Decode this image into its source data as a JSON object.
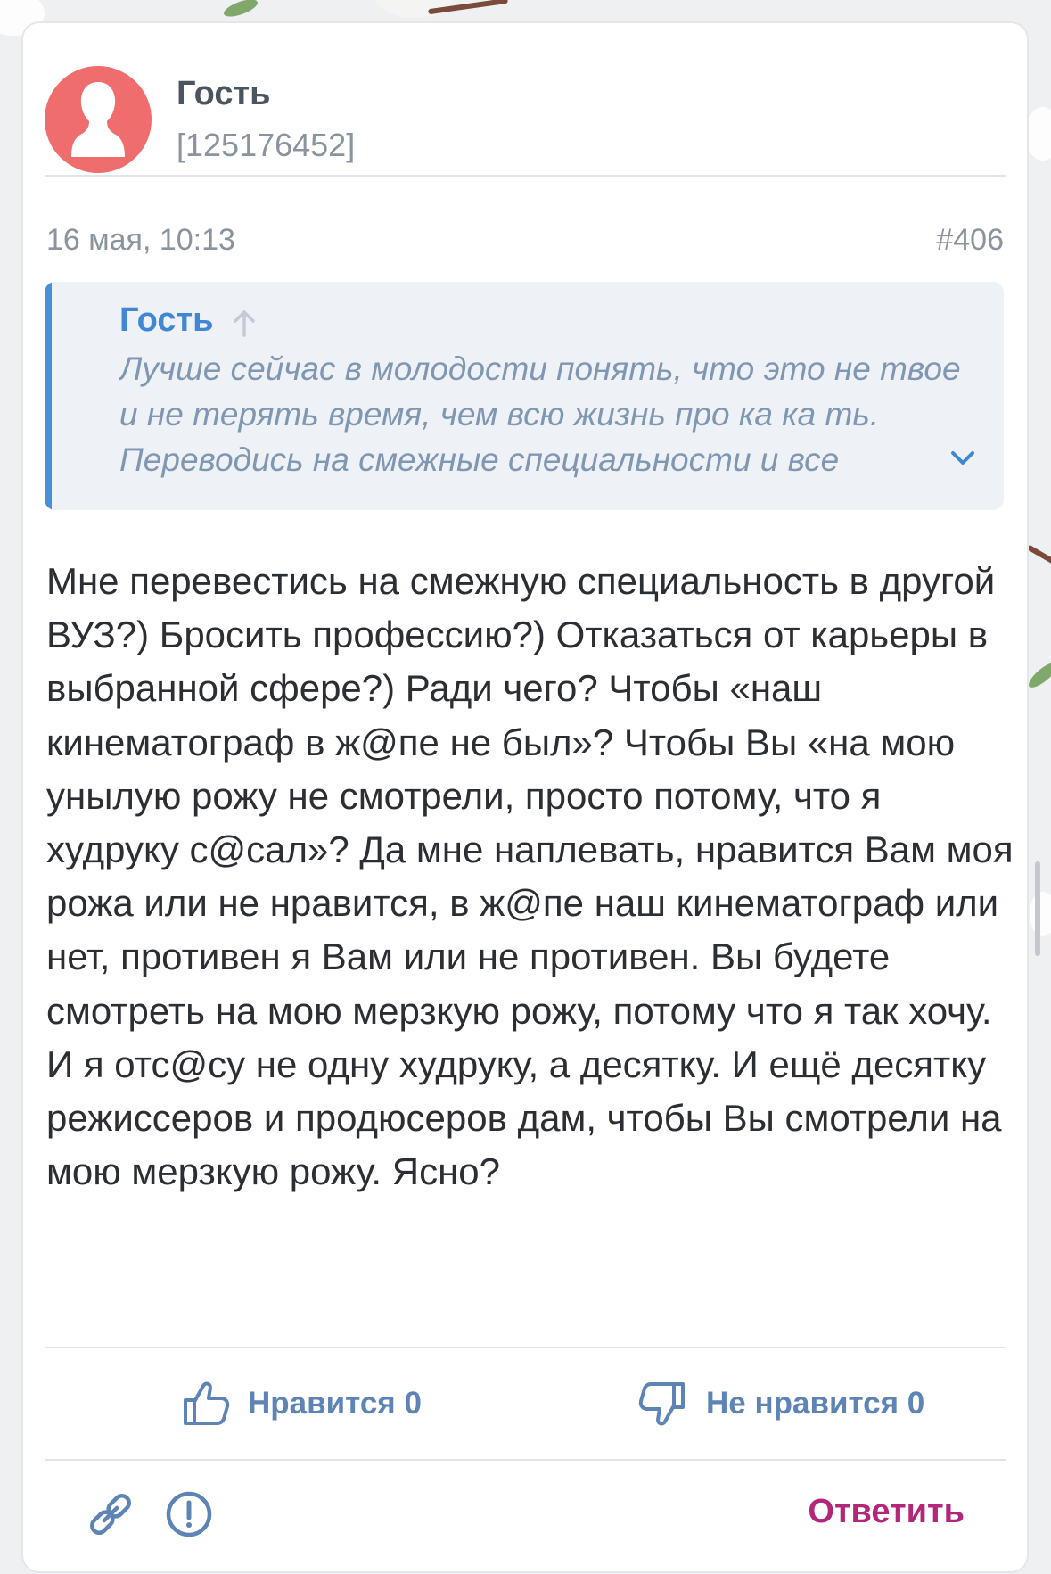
{
  "post": {
    "author": {
      "name": "Гость",
      "id": "[125176452]"
    },
    "date": "16 мая, 10:13",
    "number": "#406",
    "quote": {
      "author": "Гость",
      "text": "Лучше сейчас в молодости понять, что это не твое и не терять время, чем всю жизнь про ка ка ть. Переводись на смежные специальности и все"
    },
    "body": "Мне перевестись на смежную специальность в другой ВУЗ?) Бросить профессию?) Отказаться от карьеры в выбранной сфере?) Ради чего? Чтобы «наш кинематограф в ж@пе не был»? Чтобы Вы «на мою унылую рожу не смотрели, просто потому, что я худруку с@сал»? Да мне наплевать, нравится Вам моя рожа или не нравится, в ж@пе наш кинематограф или нет, противен я Вам или не противен. Вы будете смотреть на мою мерзкую рожу, потому что я так хочу. И я отс@су не одну худруку, а десятку. И ещё десятку режиссеров и продюсеров дам, чтобы Вы смотрели на мою мерзкую рожу. Ясно?"
  },
  "reactions": {
    "like_label": "Нравится 0",
    "dislike_label": "Не нравится 0"
  },
  "actions": {
    "reply_label": "Ответить"
  },
  "icons": {
    "avatar": "person-silhouette-icon",
    "quote_arrow": "arrow-up-icon",
    "expand": "chevron-down-icon",
    "like": "thumbs-up-icon",
    "dislike": "thumbs-down-icon",
    "link": "link-icon",
    "report": "exclamation-circle-icon"
  },
  "colors": {
    "avatar_bg": "#ef6d6d",
    "quote_accent": "#4a8fd8",
    "reaction_text": "#5d84b4",
    "reply": "#b3277a"
  }
}
